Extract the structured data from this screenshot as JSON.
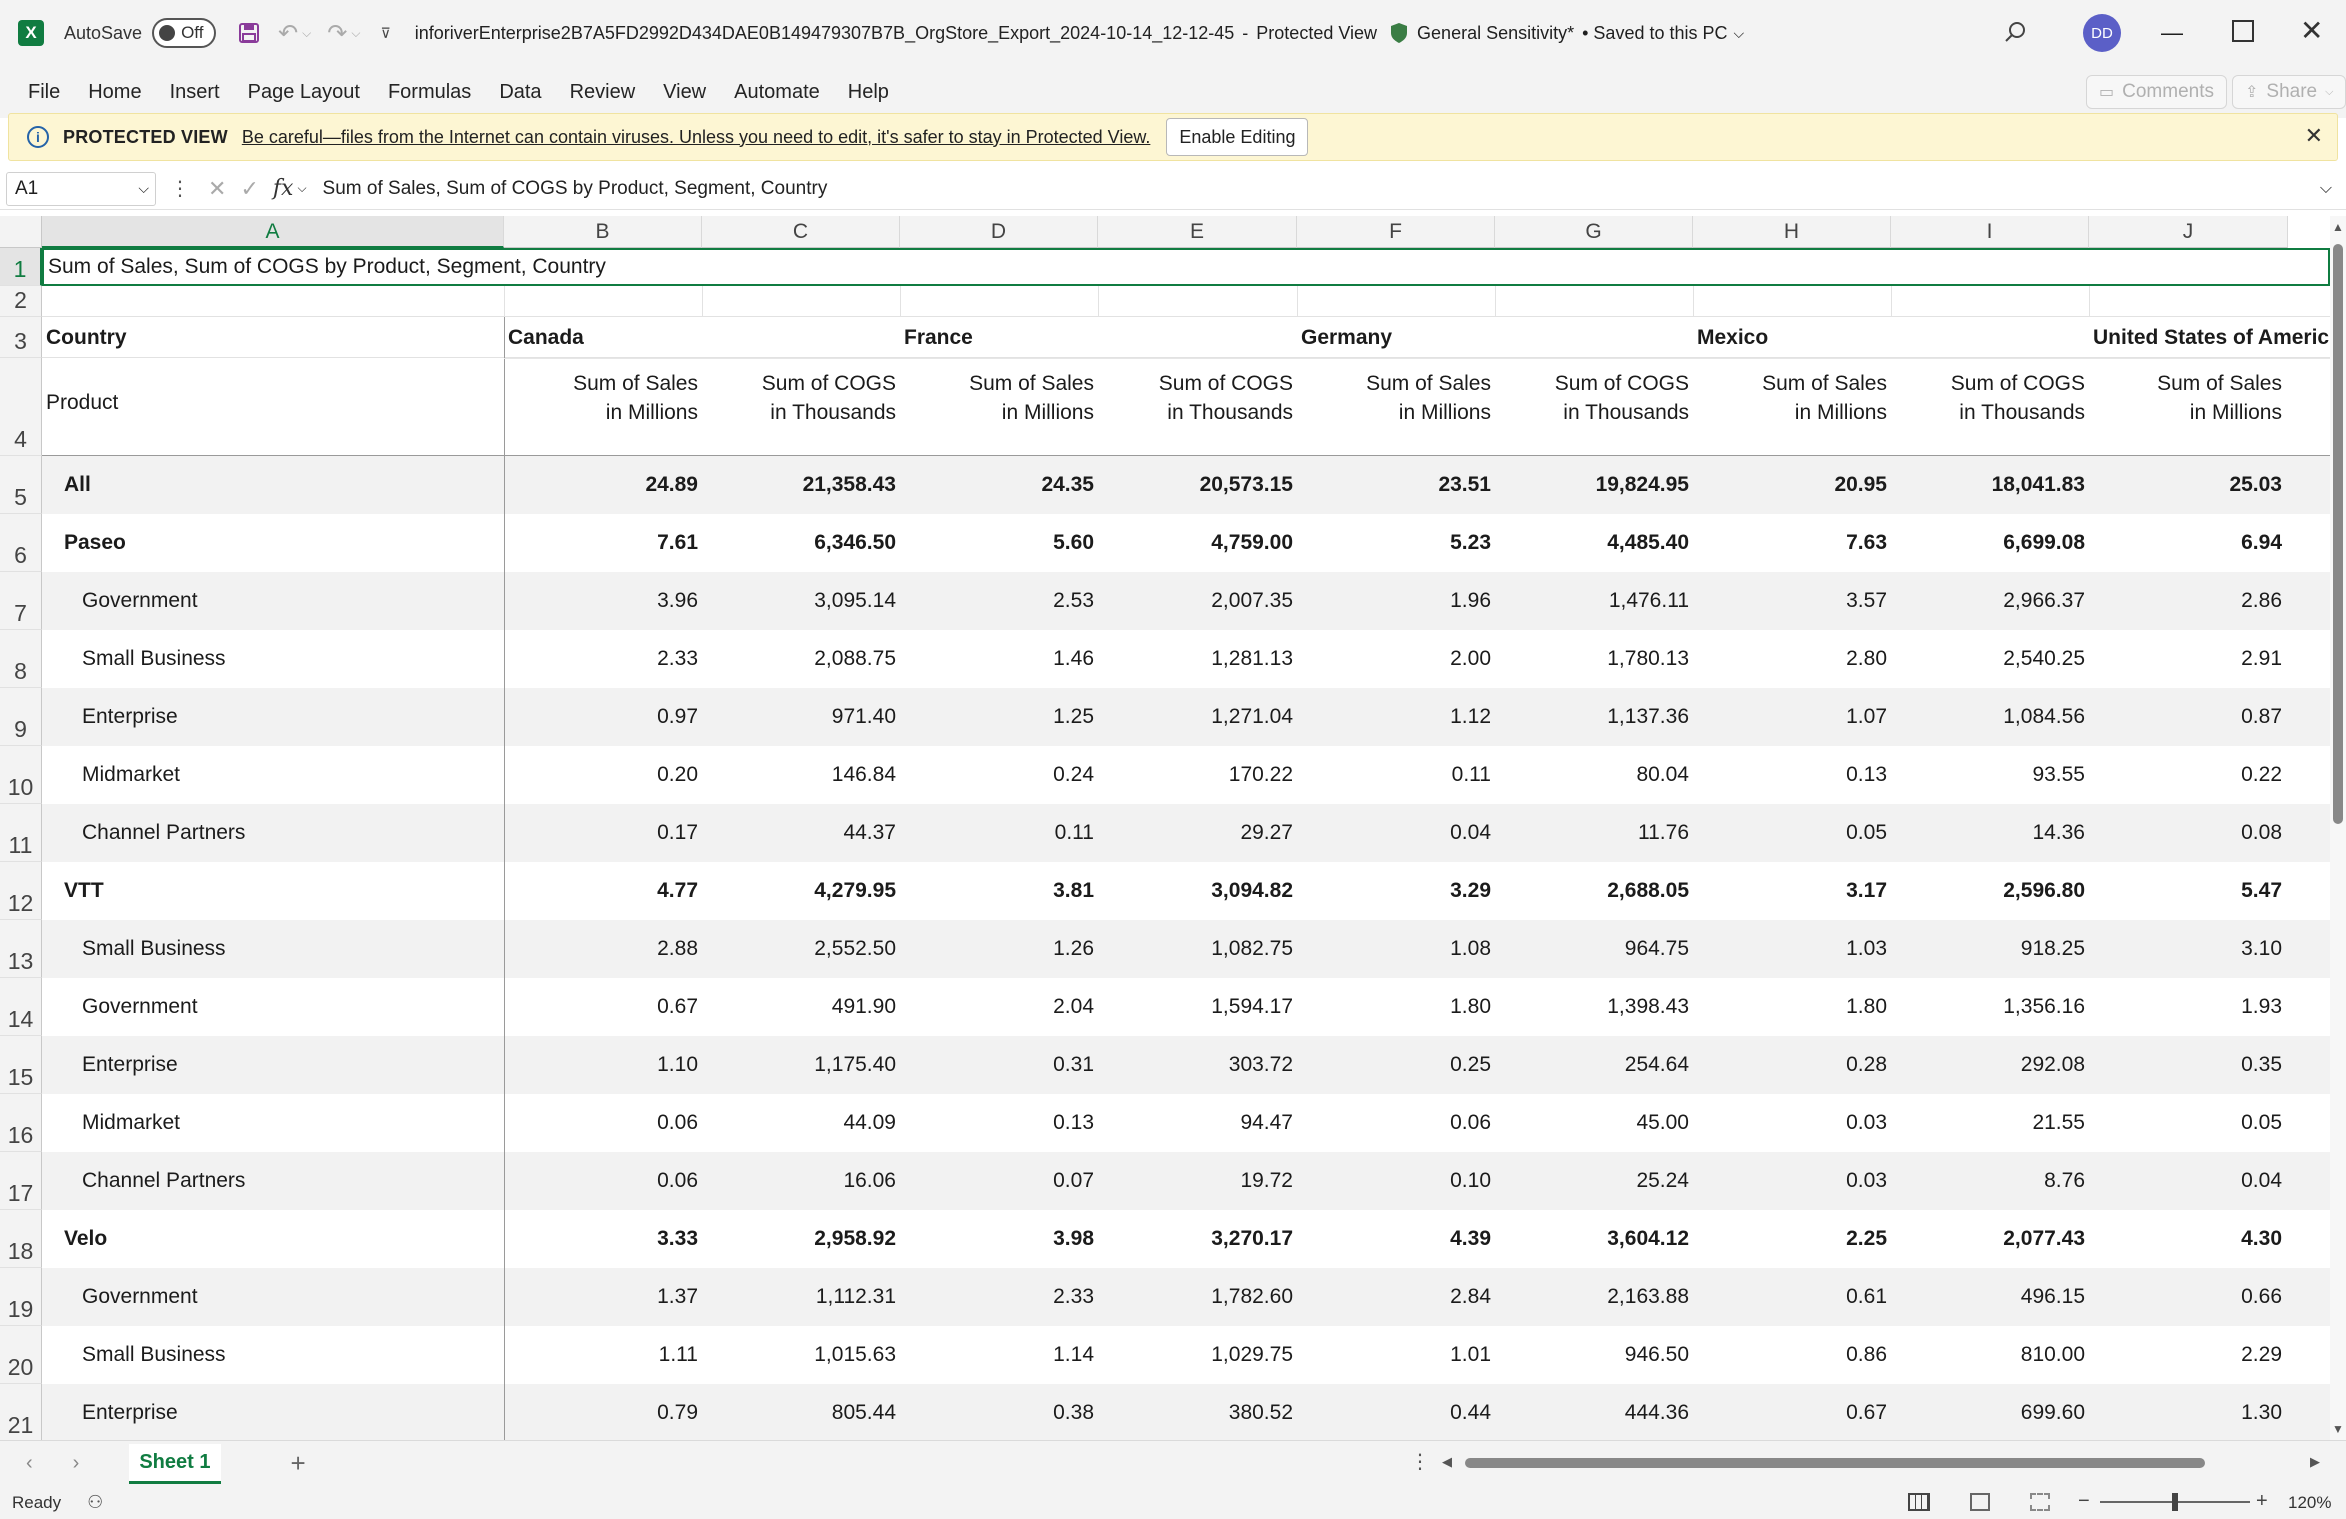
{
  "titlebar": {
    "autosave_label": "AutoSave",
    "autosave_state": "Off",
    "filename": "inforiverEnterprise2B7A5FD2992D434DAE0B149479307B7B_OrgStore_Export_2024-10-14_12-12-45",
    "separator": "-",
    "view_mode": "Protected View",
    "sensitivity": "General Sensitivity*",
    "save_status": "• Saved to this PC",
    "avatar_initials": "DD"
  },
  "menu": {
    "items": [
      "File",
      "Home",
      "Insert",
      "Page Layout",
      "Formulas",
      "Data",
      "Review",
      "View",
      "Automate",
      "Help"
    ],
    "comments": "Comments",
    "share": "Share"
  },
  "protected_view": {
    "title": "PROTECTED VIEW",
    "message": "Be careful—files from the Internet can contain viruses. Unless you need to edit, it's safer to stay in Protected View.",
    "enable_button": "Enable Editing"
  },
  "formula_bar": {
    "name_box": "A1",
    "fx_label": "fx",
    "content": "Sum of  Sales, Sum of COGS by Product, Segment, Country"
  },
  "sheet": {
    "columns": [
      "A",
      "B",
      "C",
      "D",
      "E",
      "F",
      "G",
      "H",
      "I",
      "J"
    ],
    "row_numbers": [
      "1",
      "2",
      "3",
      "4",
      "5",
      "6",
      "7",
      "8",
      "9",
      "10",
      "11",
      "12",
      "13",
      "14",
      "15",
      "16",
      "17",
      "18",
      "19",
      "20",
      "21"
    ],
    "title": "Sum of  Sales, Sum of COGS by Product, Segment, Country",
    "country_label": "Country",
    "product_label": "Product",
    "countries": [
      "Canada",
      "France",
      "Germany",
      "Mexico",
      "United States of America"
    ],
    "measure_headers": {
      "sales_line1": "Sum of  Sales",
      "sales_line2": "in Millions",
      "cogs_line1": "Sum of COGS",
      "cogs_line2": "in Thousands"
    },
    "rows": [
      {
        "label": "All",
        "level": 0,
        "values": [
          "24.89",
          "21,358.43",
          "24.35",
          "20,573.15",
          "23.51",
          "19,824.95",
          "20.95",
          "18,041.83",
          "25.03"
        ]
      },
      {
        "label": "Paseo",
        "level": 0,
        "values": [
          "7.61",
          "6,346.50",
          "5.60",
          "4,759.00",
          "5.23",
          "4,485.40",
          "7.63",
          "6,699.08",
          "6.94"
        ]
      },
      {
        "label": "Government",
        "level": 1,
        "values": [
          "3.96",
          "3,095.14",
          "2.53",
          "2,007.35",
          "1.96",
          "1,476.11",
          "3.57",
          "2,966.37",
          "2.86"
        ]
      },
      {
        "label": "Small Business",
        "level": 1,
        "values": [
          "2.33",
          "2,088.75",
          "1.46",
          "1,281.13",
          "2.00",
          "1,780.13",
          "2.80",
          "2,540.25",
          "2.91"
        ]
      },
      {
        "label": "Enterprise",
        "level": 1,
        "values": [
          "0.97",
          "971.40",
          "1.25",
          "1,271.04",
          "1.12",
          "1,137.36",
          "1.07",
          "1,084.56",
          "0.87"
        ]
      },
      {
        "label": "Midmarket",
        "level": 1,
        "values": [
          "0.20",
          "146.84",
          "0.24",
          "170.22",
          "0.11",
          "80.04",
          "0.13",
          "93.55",
          "0.22"
        ]
      },
      {
        "label": "Channel Partners",
        "level": 1,
        "values": [
          "0.17",
          "44.37",
          "0.11",
          "29.27",
          "0.04",
          "11.76",
          "0.05",
          "14.36",
          "0.08"
        ]
      },
      {
        "label": "VTT",
        "level": 0,
        "values": [
          "4.77",
          "4,279.95",
          "3.81",
          "3,094.82",
          "3.29",
          "2,688.05",
          "3.17",
          "2,596.80",
          "5.47"
        ]
      },
      {
        "label": "Small Business",
        "level": 1,
        "values": [
          "2.88",
          "2,552.50",
          "1.26",
          "1,082.75",
          "1.08",
          "964.75",
          "1.03",
          "918.25",
          "3.10"
        ]
      },
      {
        "label": "Government",
        "level": 1,
        "values": [
          "0.67",
          "491.90",
          "2.04",
          "1,594.17",
          "1.80",
          "1,398.43",
          "1.80",
          "1,356.16",
          "1.93"
        ]
      },
      {
        "label": "Enterprise",
        "level": 1,
        "values": [
          "1.10",
          "1,175.40",
          "0.31",
          "303.72",
          "0.25",
          "254.64",
          "0.28",
          "292.08",
          "0.35"
        ]
      },
      {
        "label": "Midmarket",
        "level": 1,
        "values": [
          "0.06",
          "44.09",
          "0.13",
          "94.47",
          "0.06",
          "45.00",
          "0.03",
          "21.55",
          "0.05"
        ]
      },
      {
        "label": "Channel Partners",
        "level": 1,
        "values": [
          "0.06",
          "16.06",
          "0.07",
          "19.72",
          "0.10",
          "25.24",
          "0.03",
          "8.76",
          "0.04"
        ]
      },
      {
        "label": "Velo",
        "level": 0,
        "values": [
          "3.33",
          "2,958.92",
          "3.98",
          "3,270.17",
          "4.39",
          "3,604.12",
          "2.25",
          "2,077.43",
          "4.30"
        ]
      },
      {
        "label": "Government",
        "level": 1,
        "values": [
          "1.37",
          "1,112.31",
          "2.33",
          "1,782.60",
          "2.84",
          "2,163.88",
          "0.61",
          "496.15",
          "0.66"
        ]
      },
      {
        "label": "Small Business",
        "level": 1,
        "values": [
          "1.11",
          "1,015.63",
          "1.14",
          "1,029.75",
          "1.01",
          "946.50",
          "0.86",
          "810.00",
          "2.29"
        ]
      },
      {
        "label": "Enterprise",
        "level": 1,
        "values": [
          "0.79",
          "805.44",
          "0.38",
          "380.52",
          "0.44",
          "444.36",
          "0.67",
          "699.60",
          "1.30"
        ]
      }
    ]
  },
  "sheet_tabs": {
    "active": "Sheet 1",
    "add": "+"
  },
  "status": {
    "ready": "Ready",
    "zoom": "120%"
  },
  "colors": {
    "excel_green": "#107c41",
    "banded_row": "#f2f2f2",
    "pv_background": "#fdf6d3"
  }
}
